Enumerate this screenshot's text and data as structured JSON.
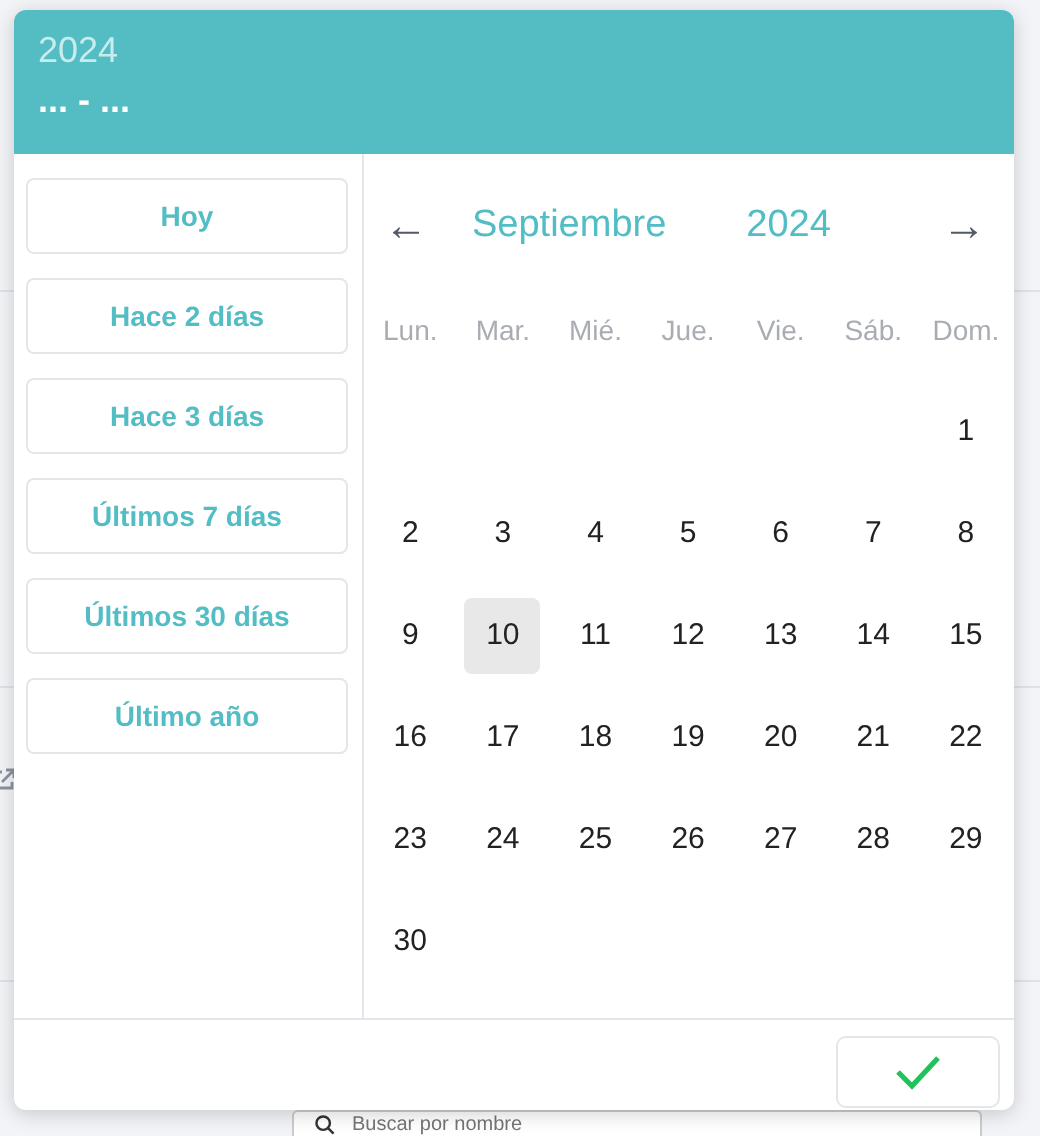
{
  "background": {
    "search": {
      "placeholder": "Buscar por nombre"
    }
  },
  "header": {
    "year": "2024",
    "range": "... - ..."
  },
  "shortcuts": [
    {
      "label": "Hoy"
    },
    {
      "label": "Hace 2 días"
    },
    {
      "label": "Hace 3 días"
    },
    {
      "label": "Últimos 7 días"
    },
    {
      "label": "Últimos 30 días"
    },
    {
      "label": "Último año"
    }
  ],
  "nav": {
    "prev": "←",
    "month": "Septiembre",
    "year": "2024",
    "next": "→"
  },
  "weekdays": [
    "Lun.",
    "Mar.",
    "Mié.",
    "Jue.",
    "Vie.",
    "Sáb.",
    "Dom."
  ],
  "weeks": [
    [
      {
        "kind": "blank"
      },
      {
        "kind": "blank"
      },
      {
        "kind": "blank"
      },
      {
        "kind": "blank"
      },
      {
        "kind": "blank"
      },
      {
        "kind": "blank"
      },
      {
        "kind": "day",
        "label": "1",
        "today": false
      }
    ],
    [
      {
        "kind": "day",
        "label": "2",
        "today": false
      },
      {
        "kind": "day",
        "label": "3",
        "today": false
      },
      {
        "kind": "day",
        "label": "4",
        "today": false
      },
      {
        "kind": "day",
        "label": "5",
        "today": false
      },
      {
        "kind": "day",
        "label": "6",
        "today": false
      },
      {
        "kind": "day",
        "label": "7",
        "today": false
      },
      {
        "kind": "day",
        "label": "8",
        "today": false
      }
    ],
    [
      {
        "kind": "day",
        "label": "9",
        "today": false
      },
      {
        "kind": "day",
        "label": "10",
        "today": true
      },
      {
        "kind": "day",
        "label": "11",
        "today": false
      },
      {
        "kind": "day",
        "label": "12",
        "today": false
      },
      {
        "kind": "day",
        "label": "13",
        "today": false
      },
      {
        "kind": "day",
        "label": "14",
        "today": false
      },
      {
        "kind": "day",
        "label": "15",
        "today": false
      }
    ],
    [
      {
        "kind": "day",
        "label": "16",
        "today": false
      },
      {
        "kind": "day",
        "label": "17",
        "today": false
      },
      {
        "kind": "day",
        "label": "18",
        "today": false
      },
      {
        "kind": "day",
        "label": "19",
        "today": false
      },
      {
        "kind": "day",
        "label": "20",
        "today": false
      },
      {
        "kind": "day",
        "label": "21",
        "today": false
      },
      {
        "kind": "day",
        "label": "22",
        "today": false
      }
    ],
    [
      {
        "kind": "day",
        "label": "23",
        "today": false
      },
      {
        "kind": "day",
        "label": "24",
        "today": false
      },
      {
        "kind": "day",
        "label": "25",
        "today": false
      },
      {
        "kind": "day",
        "label": "26",
        "today": false
      },
      {
        "kind": "day",
        "label": "27",
        "today": false
      },
      {
        "kind": "day",
        "label": "28",
        "today": false
      },
      {
        "kind": "day",
        "label": "29",
        "today": false
      }
    ],
    [
      {
        "kind": "day",
        "label": "30",
        "today": false
      }
    ]
  ]
}
